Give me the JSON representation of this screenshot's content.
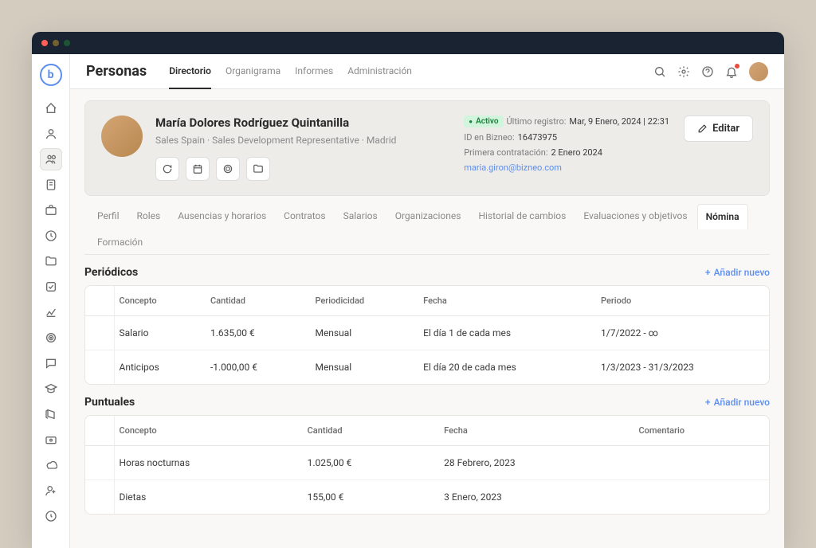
{
  "header": {
    "title": "Personas",
    "tabs": [
      "Directorio",
      "Organigrama",
      "Informes",
      "Administración"
    ]
  },
  "profile": {
    "name": "María Dolores Rodríguez Quintanilla",
    "subtitle": "Sales Spain · Sales Development Representative · Madrid",
    "status": "Activo",
    "lastLoginLabel": "Último registro:",
    "lastLogin": "Mar, 9 Enero, 2024 | 22:31",
    "idLabel": "ID en Bizneo:",
    "id": "16473975",
    "firstHireLabel": "Primera contratación:",
    "firstHire": "2 Enero 2024",
    "email": "maria.giron@bizneo.com",
    "editLabel": "Editar"
  },
  "subtabs": [
    "Perfil",
    "Roles",
    "Ausencias y horarios",
    "Contratos",
    "Salarios",
    "Organizaciones",
    "Historial de cambios",
    "Evaluaciones y objetivos",
    "Nómina",
    "Formación"
  ],
  "sections": {
    "periodic": {
      "title": "Periódicos",
      "addLabel": "Añadir nuevo",
      "headers": [
        "Concepto",
        "Cantidad",
        "Periodicidad",
        "Fecha",
        "Periodo"
      ],
      "rows": [
        {
          "concepto": "Salario",
          "cantidad": "1.635,00 €",
          "periodicidad": "Mensual",
          "fecha": "El día 1 de cada mes",
          "periodo": "1/7/2022 - ∞"
        },
        {
          "concepto": "Anticipos",
          "cantidad": "-1.000,00 €",
          "periodicidad": "Mensual",
          "fecha": "El día 20 de cada mes",
          "periodo": "1/3/2023 - 31/3/2023"
        }
      ]
    },
    "punctual": {
      "title": "Puntuales",
      "addLabel": "Añadir nuevo",
      "headers": [
        "Concepto",
        "Cantidad",
        "Fecha",
        "Comentario"
      ],
      "rows": [
        {
          "concepto": "Horas nocturnas",
          "cantidad": "1.025,00 €",
          "fecha": "28 Febrero, 2023",
          "comentario": ""
        },
        {
          "concepto": "Dietas",
          "cantidad": "155,00 €",
          "fecha": "3 Enero, 2023",
          "comentario": ""
        }
      ]
    }
  }
}
